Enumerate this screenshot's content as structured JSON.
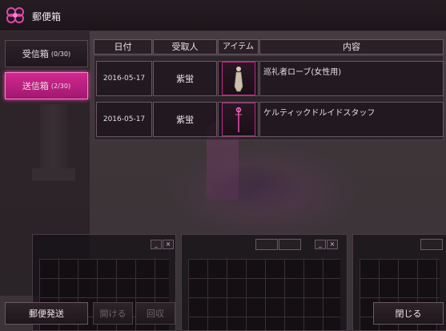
{
  "window": {
    "title": "郵便箱"
  },
  "nav": {
    "inbox": {
      "label": "受信箱",
      "count": "(0/30)"
    },
    "outbox": {
      "label": "送信箱",
      "count": "(2/30)"
    }
  },
  "table": {
    "headers": [
      "日付",
      "受取人",
      "アイテム",
      "内容"
    ],
    "rows": [
      {
        "date": "2016-05-17",
        "recipient": "紫蛍",
        "item_icon": "robe-figure-icon",
        "content": "巡礼者ローブ(女性用)"
      },
      {
        "date": "2016-05-17",
        "recipient": "紫蛍",
        "item_icon": "staff-icon",
        "content": "ケルティックドルイドスタッフ"
      }
    ]
  },
  "buttons": {
    "send": "郵便発送",
    "open": "開ける",
    "recall": "回収",
    "close": "閉じる"
  },
  "colors": {
    "accent": "#d0288e",
    "border": "#6b5663"
  }
}
